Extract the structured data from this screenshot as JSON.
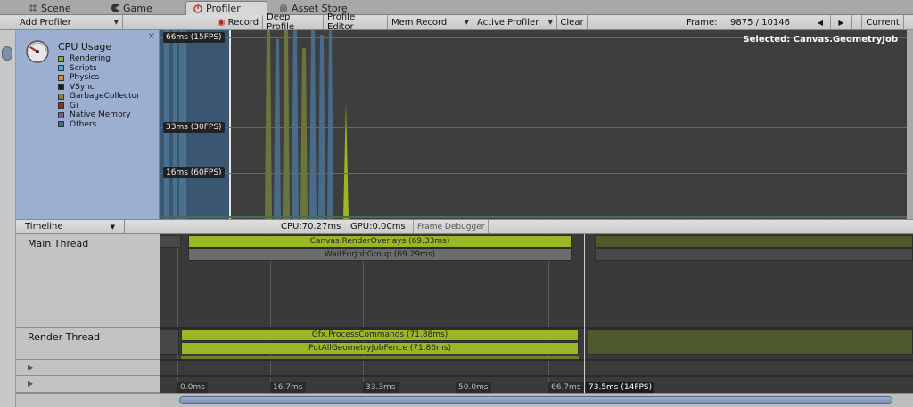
{
  "tabs": [
    {
      "label": "Scene",
      "icon": "grid-icon"
    },
    {
      "label": "Game",
      "icon": "pacman-icon"
    },
    {
      "label": "Profiler",
      "icon": "profiler-icon",
      "active": true
    },
    {
      "label": "Asset Store",
      "icon": "store-icon"
    }
  ],
  "toolbar": {
    "add_profiler": "Add Profiler",
    "record": "Record",
    "deep_profile": "Deep Profile",
    "profile_editor": "Profile Editor",
    "mem_record": "Mem Record",
    "active_profiler": "Active Profiler",
    "clear": "Clear",
    "frame_label": "Frame:",
    "frame_value": "9875 / 10146",
    "prev": "◀",
    "next": "▶",
    "current": "Current"
  },
  "cpu_panel": {
    "title": "CPU Usage",
    "close": "×",
    "legend": [
      {
        "label": "Rendering",
        "color": "#7fae3a"
      },
      {
        "label": "Scripts",
        "color": "#4f9fcf"
      },
      {
        "label": "Physics",
        "color": "#e08a2f"
      },
      {
        "label": "VSync",
        "color": "#1b1b1b"
      },
      {
        "label": "GarbageCollector",
        "color": "#8f7f3f"
      },
      {
        "label": "Gi",
        "color": "#8f2f1f"
      },
      {
        "label": "Native Memory",
        "color": "#8f4f9f"
      },
      {
        "label": "Others",
        "color": "#3f6f8f"
      }
    ]
  },
  "graph": {
    "selected_label": "Selected: Canvas.GeometryJob",
    "y_markers": [
      "66ms (15FPS)",
      "33ms (30FPS)",
      "16ms (60FPS)"
    ]
  },
  "timeline_header": {
    "mode": "Timeline",
    "cpu": "CPU:70.27ms",
    "gpu": "GPU:0.00ms",
    "frame_debugger": "Frame Debugger"
  },
  "threads": {
    "main": "Main Thread",
    "render": "Render Thread"
  },
  "samples": {
    "canvas_render": "Canvas.RenderOverlays (69.33ms)",
    "wait_job": "WaitForJobGroup (69.29ms)",
    "gfx_process": "Gfx.ProcessCommands (71.88ms)",
    "put_geometry": "PutAllGeometryJobFence (71.86ms)"
  },
  "time_ruler": [
    "0.0ms",
    "16.7ms",
    "33.3ms",
    "50.0ms",
    "66.7ms"
  ],
  "time_selected": "73.5ms (14FPS)"
}
